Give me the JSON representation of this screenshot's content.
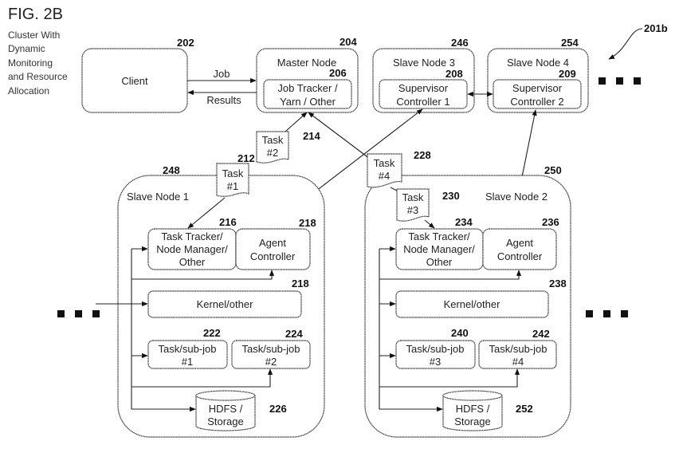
{
  "figure": {
    "label": "FIG. 2B",
    "caption": [
      "Cluster With",
      "Dynamic",
      "Monitoring",
      "and Resource",
      "Allocation"
    ],
    "ref": "201b"
  },
  "client": {
    "label": "Client",
    "ref": "202"
  },
  "master": {
    "title": "Master Node",
    "ref": "204",
    "inner": [
      "Job Tracker /",
      "Yarn / Other"
    ],
    "inner_ref": "206"
  },
  "flows": {
    "job": "Job",
    "results": "Results"
  },
  "slave3": {
    "title": "Slave Node 3",
    "ref": "246",
    "inner": [
      "Supervisor",
      "Controller 1"
    ],
    "inner_ref": "208"
  },
  "slave4": {
    "title": "Slave Node 4",
    "ref": "254",
    "inner": [
      "Supervisor",
      "Controller 2"
    ],
    "inner_ref": "209"
  },
  "tasks": {
    "t1": {
      "lines": [
        "Task",
        "#1"
      ],
      "ref": "212"
    },
    "t2": {
      "lines": [
        "Task",
        "#2"
      ],
      "ref": "214"
    },
    "t4": {
      "lines": [
        "Task",
        "#4"
      ],
      "ref": "228"
    },
    "t3": {
      "lines": [
        "Task",
        "#3"
      ],
      "ref": "230"
    }
  },
  "slave1": {
    "title": "Slave Node 1",
    "ref": "248",
    "tracker": {
      "lines": [
        "Task Tracker/",
        "Node Manager/",
        "Other"
      ],
      "ref": "216"
    },
    "agent": {
      "lines": [
        "Agent",
        "Controller"
      ],
      "ref": "218"
    },
    "kernel": {
      "label": "Kernel/other",
      "ref": "218"
    },
    "sub1": {
      "lines": [
        "Task/sub-job",
        "#1"
      ],
      "ref": "222"
    },
    "sub2": {
      "lines": [
        "Task/sub-job",
        "#2"
      ],
      "ref": "224"
    },
    "storage": {
      "lines": [
        "HDFS /",
        "Storage"
      ],
      "ref": "226"
    }
  },
  "slave2": {
    "title": "Slave Node 2",
    "ref": "250",
    "tracker": {
      "lines": [
        "Task Tracker/",
        "Node Manager/",
        "Other"
      ],
      "ref": "234"
    },
    "agent": {
      "lines": [
        "Agent",
        "Controller"
      ],
      "ref": "236"
    },
    "kernel": {
      "label": "Kernel/other",
      "ref": "238"
    },
    "sub1": {
      "lines": [
        "Task/sub-job",
        "#3"
      ],
      "ref": "240"
    },
    "sub2": {
      "lines": [
        "Task/sub-job",
        "#4"
      ],
      "ref": "242"
    },
    "storage": {
      "lines": [
        "HDFS /",
        "Storage"
      ],
      "ref": "252"
    }
  }
}
